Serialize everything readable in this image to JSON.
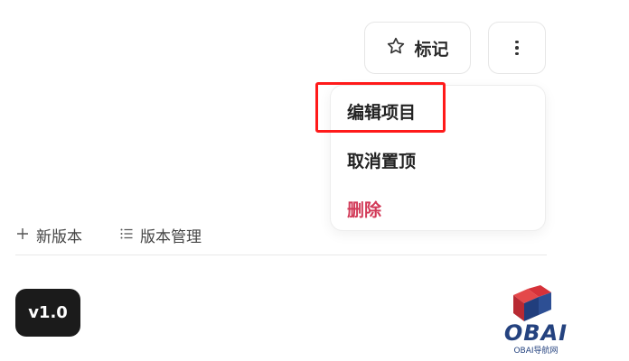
{
  "toolbar": {
    "mark_label": "标记",
    "more_icon": "more-vertical-icon",
    "star_icon": "star-icon"
  },
  "menu": {
    "items": [
      {
        "label": "编辑项目"
      },
      {
        "label": "取消置顶"
      },
      {
        "label": "删除",
        "color": "#d23a58"
      }
    ]
  },
  "actions": {
    "new_version": "新版本",
    "version_management": "版本管理"
  },
  "version": {
    "badge": "v1.0"
  },
  "watermark": {
    "text": "OBAI",
    "subtext": "OBAI导航网"
  },
  "colors": {
    "highlight": "#ff1a1a",
    "danger": "#d23a58",
    "badge_bg": "#1b1b1b"
  }
}
